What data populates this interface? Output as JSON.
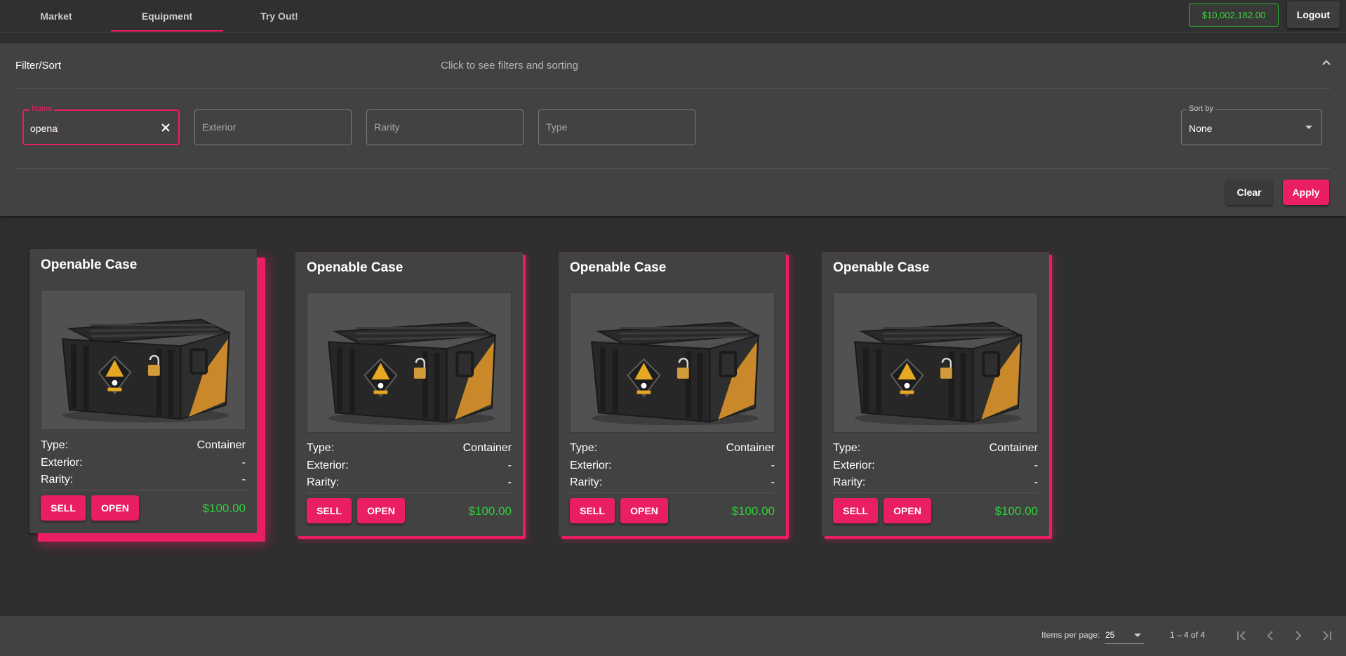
{
  "nav": {
    "tabs": [
      {
        "label": "Market"
      },
      {
        "label": "Equipment"
      },
      {
        "label": "Try Out!"
      }
    ],
    "balance": "$10,002,182.00",
    "logout_label": "Logout"
  },
  "filter": {
    "title": "Filter/Sort",
    "description": "Click to see filters and sorting",
    "name_label": "Name",
    "name_value": "opena",
    "exterior_placeholder": "Exterior",
    "rarity_placeholder": "Rarity",
    "type_placeholder": "Type",
    "sort_label": "Sort by",
    "sort_value": "None",
    "clear_label": "Clear",
    "apply_label": "Apply"
  },
  "cards": [
    {
      "name": "Openable Case",
      "type_label": "Type:",
      "type": "Container",
      "exterior_label": "Exterior:",
      "exterior": "-",
      "rarity_label": "Rarity:",
      "rarity": "-",
      "sell_label": "SELL",
      "open_label": "OPEN",
      "price": "$100.00"
    },
    {
      "name": "Openable Case",
      "type_label": "Type:",
      "type": "Container",
      "exterior_label": "Exterior:",
      "exterior": "-",
      "rarity_label": "Rarity:",
      "rarity": "-",
      "sell_label": "SELL",
      "open_label": "OPEN",
      "price": "$100.00"
    },
    {
      "name": "Openable Case",
      "type_label": "Type:",
      "type": "Container",
      "exterior_label": "Exterior:",
      "exterior": "-",
      "rarity_label": "Rarity:",
      "rarity": "-",
      "sell_label": "SELL",
      "open_label": "OPEN",
      "price": "$100.00"
    },
    {
      "name": "Openable Case",
      "type_label": "Type:",
      "type": "Container",
      "exterior_label": "Exterior:",
      "exterior": "-",
      "rarity_label": "Rarity:",
      "rarity": "-",
      "sell_label": "SELL",
      "open_label": "OPEN",
      "price": "$100.00"
    }
  ],
  "paginator": {
    "items_per_page_label": "Items per page:",
    "items_per_page": "25",
    "range": "1 – 4 of 4"
  },
  "icons": {
    "collapse": "chevron-up-icon",
    "clear": "close-icon",
    "first": "first-page-icon",
    "prev": "chevron-left-icon",
    "next": "chevron-right-icon",
    "last": "last-page-icon",
    "case_image": "weapon-case-image"
  },
  "colors": {
    "accent": "#ea1e63",
    "price": "#2ed13a",
    "background": "#2f2f2f",
    "surface": "#424242"
  }
}
